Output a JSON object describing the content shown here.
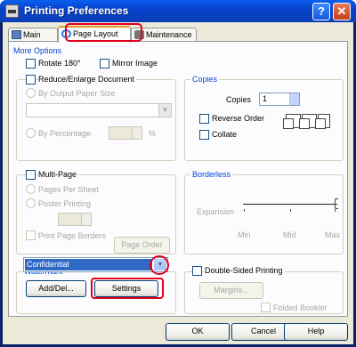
{
  "window": {
    "title": "Printing Preferences",
    "help_label": "?",
    "close_label": "✕"
  },
  "tabs": [
    {
      "label": "Main",
      "icon": "printer-icon"
    },
    {
      "label": "Page Layout",
      "icon": "page-layout-icon"
    },
    {
      "label": "Maintenance",
      "icon": "maintenance-icon"
    }
  ],
  "more_options": {
    "title": "More Options",
    "rotate_label": "Rotate 180°",
    "mirror_label": "Mirror Image"
  },
  "reduce": {
    "label": "Reduce/Enlarge Document",
    "by_output_label": "By Output Paper Size",
    "by_percentage_label": "By Percentage",
    "percent_unit": "%"
  },
  "copies": {
    "title": "Copies",
    "copies_label": "Copies",
    "copies_value": "1",
    "reverse_label": "Reverse Order",
    "collate_label": "Collate"
  },
  "multipage": {
    "label": "Multi-Page",
    "pages_per_sheet_label": "Pages Per Sheet",
    "poster_label": "Poster Printing",
    "print_borders_label": "Print Page Borders",
    "page_order_label": "Page Order"
  },
  "borderless": {
    "title": "Borderless",
    "expansion_label": "Expansion",
    "min_label": "Min",
    "mid_label": "Mid",
    "max_label": "Max",
    "level": "max"
  },
  "watermark": {
    "title": "Watermark",
    "selected": "Confidential",
    "add_label": "Add/Del...",
    "settings_label": "Settings"
  },
  "duplex": {
    "label": "Double-Sided Printing",
    "margins_label": "Margins...",
    "folded_label": "Folded Booklet"
  },
  "footer": {
    "ok_label": "OK",
    "cancel_label": "Cancel",
    "help_label": "Help"
  },
  "colors": {
    "highlight": "#e0001b",
    "accent": "#0046d5",
    "titlebar": "#0a5ff0"
  }
}
